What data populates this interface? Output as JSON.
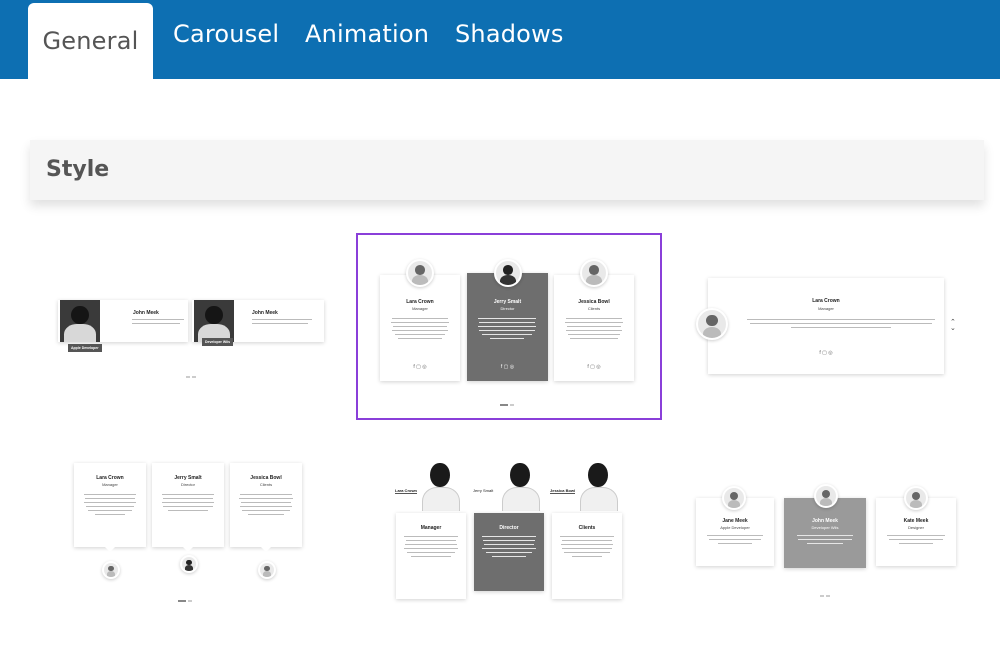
{
  "tabs": [
    {
      "label": "General",
      "active": true
    },
    {
      "label": "Carousel",
      "active": false
    },
    {
      "label": "Animation",
      "active": false
    },
    {
      "label": "Shadows",
      "active": false
    }
  ],
  "section": {
    "title": "Style"
  },
  "colors": {
    "tabbar": "#0d6fb2",
    "selected_border": "#8a3fd9",
    "header_bg": "#f5f5f5"
  },
  "style_options": [
    {
      "id": "style-1",
      "items": [
        {
          "name": "John Meek",
          "label": "Apple Developer"
        },
        {
          "name": "John Meek",
          "label": "Developer Wiis"
        }
      ]
    },
    {
      "id": "style-2",
      "selected": true,
      "items": [
        {
          "name": "Lara Crown",
          "role": "Manager",
          "text": "High level of equipment and doctors. There are no queues and cheap prices. There are interesting complex programs for examination of the whole organism. Very good medical center, I recommend!"
        },
        {
          "name": "Jerry Smalt",
          "role": "Director",
          "text": "Thanks to the best podiatricians in your center. Every time I address and receive a high level professional treatment recommend you all my friends and acquaintances."
        },
        {
          "name": "Jessica Bowl",
          "role": "Clients",
          "text": "I want to express my deep gratitude to the surgery John Valley for his high professionalism. Very accurately and qualitatively performs its work. It's not the first time I've been referring this doctor."
        }
      ]
    },
    {
      "id": "style-3",
      "items": [
        {
          "name": "Lara Crown",
          "role": "Manager",
          "text": "High level of equipment and doctors. There are no queues and cheap prices. There are interesting complex programs for examination of the whole organism. Very good medical center, I recommend!"
        }
      ]
    },
    {
      "id": "style-4",
      "items": [
        {
          "name": "Lara Crown",
          "role": "Manager",
          "text": "High level of equipment and doctors. There are no queues and cheap prices. There are interesting complex programs for examination of the whole organism. Very good medical center, I recommend!"
        },
        {
          "name": "Jerry Smalt",
          "role": "Director",
          "text": "Thanks to the best podiatricians in your center. Every time I address and receive a high level professional treatment recommend you all my friends and acquaintances."
        },
        {
          "name": "Jessica Bowl",
          "role": "Clients",
          "text": "I want to express my deep gratitude to the surgery John Valley for his high professionalism. Very accurately and qualitatively performs its work. It's not the first time I've been referring this doctor."
        }
      ]
    },
    {
      "id": "style-5",
      "items": [
        {
          "name": "Lara Crown",
          "role": "Manager",
          "text": "High level of equipment and doctors. There are no queues and cheap prices. There are interesting complex programs for examination of the whole organism. Very good medical center, I recommend!"
        },
        {
          "name": "Jerry Smalt",
          "role": "Director",
          "text": "Thanks to the best podiatricians in your center. Every time I address and receive a high level professional treatment recommend you all my friends and acquaintances."
        },
        {
          "name": "Jessica Bowl",
          "role": "Clients",
          "text": "I want to express my deep gratitude to the surgery John Valley for his high professionalism. Very accurately and qualitatively performs its work. It's not the first time I've been referring this doctor."
        }
      ]
    },
    {
      "id": "style-6",
      "items": [
        {
          "name": "Jane Meek",
          "role": "Apple Developer"
        },
        {
          "name": "John Meek",
          "role": "Developer Wiis"
        },
        {
          "name": "Kate Meek",
          "role": "Designer"
        }
      ]
    }
  ],
  "social_icons": [
    "facebook-icon",
    "vimeo-icon",
    "instagram-icon"
  ],
  "social_glyphs": "f ▢ ◎"
}
